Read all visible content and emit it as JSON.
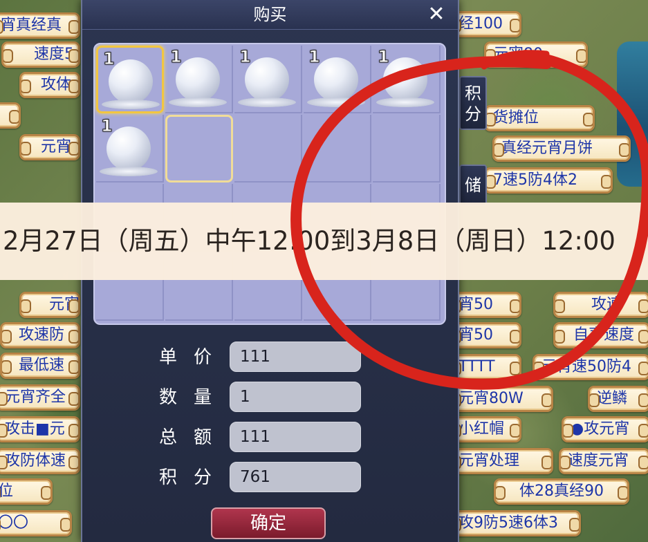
{
  "dialog": {
    "title": "购买",
    "close_symbol": "✕",
    "items": [
      {
        "count": "1",
        "icon": "snowball-icon"
      },
      {
        "count": "1",
        "icon": "snowball-icon"
      },
      {
        "count": "1",
        "icon": "snowball-icon"
      },
      {
        "count": "1",
        "icon": "snowball-icon"
      },
      {
        "count": "1",
        "icon": "snowball-icon"
      },
      {
        "count": "1",
        "icon": "snowball-icon"
      }
    ],
    "side_tabs": {
      "tab1": "积分",
      "tab2": "储"
    },
    "fields": {
      "unit_price_label": "单价",
      "unit_price_value": "111",
      "quantity_label": "数量",
      "quantity_value": "1",
      "total_label": "总额",
      "total_value": "111",
      "points_label": "积分",
      "points_value": "761"
    },
    "confirm_label": "确定"
  },
  "banner": {
    "text": "2月27日（周五）中午12:00到3月8日（周日）12:00"
  },
  "stall_tags": {
    "left": [
      "宵真经真",
      "速度5",
      "攻体",
      "元宵",
      "元宵",
      "攻速防",
      "最低速",
      "元宵齐全",
      "攻击■元",
      "攻防体速",
      "位",
      "〇〇"
    ],
    "right": [
      "经100",
      "元宵80",
      "货摊位",
      "真经元宵月饼",
      "7速5防4体2",
      "宵50",
      "攻速",
      "宵50",
      "自声速度",
      "TTTT",
      "元宵速50防4",
      "元宵80W",
      "逆鳞",
      "小红帽",
      "●攻元宵",
      "元宵处理",
      "速度元宵",
      "体28真经90",
      "攻9防5速6体3"
    ]
  },
  "colors": {
    "annotation": "#d8241c",
    "tag_text": "#1d35a8",
    "grid_bg": "#a7a9d8",
    "dialog_bg": "#2c3550"
  }
}
